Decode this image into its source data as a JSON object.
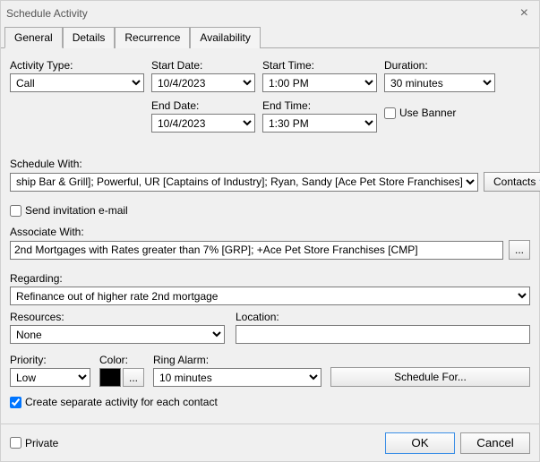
{
  "window": {
    "title": "Schedule Activity"
  },
  "tabs": {
    "general": "General",
    "details": "Details",
    "recurrence": "Recurrence",
    "availability": "Availability"
  },
  "labels": {
    "activity_type": "Activity Type:",
    "start_date": "Start Date:",
    "start_time": "Start Time:",
    "duration": "Duration:",
    "end_date": "End Date:",
    "end_time": "End Time:",
    "use_banner": "Use Banner",
    "schedule_with": "Schedule With:",
    "contacts_btn": "Contacts",
    "send_invite": "Send invitation e-mail",
    "associate_with": "Associate With:",
    "regarding": "Regarding:",
    "resources": "Resources:",
    "location": "Location:",
    "priority": "Priority:",
    "color": "Color:",
    "ring_alarm": "Ring Alarm:",
    "schedule_for": "Schedule For...",
    "create_separate": "Create separate activity for each contact",
    "private": "Private",
    "ok": "OK",
    "cancel": "Cancel",
    "ellipsis": "..."
  },
  "values": {
    "activity_type": "Call",
    "start_date": "10/4/2023",
    "end_date": "10/4/2023",
    "start_time": "1:00 PM",
    "end_time": "1:30 PM",
    "duration": "30 minutes",
    "schedule_with": "ship Bar & Grill]; Powerful, UR [Captains of Industry]; Ryan, Sandy [Ace Pet Store Franchises]",
    "associate_with": "2nd Mortgages with Rates greater than 7% [GRP]; +Ace Pet Store Franchises [CMP]",
    "regarding": "Refinance out of higher rate 2nd mortgage",
    "resources": "None",
    "location": "",
    "priority": "Low",
    "ring_alarm": "10 minutes",
    "send_invite_checked": false,
    "use_banner_checked": false,
    "create_separate_checked": true,
    "private_checked": false
  }
}
